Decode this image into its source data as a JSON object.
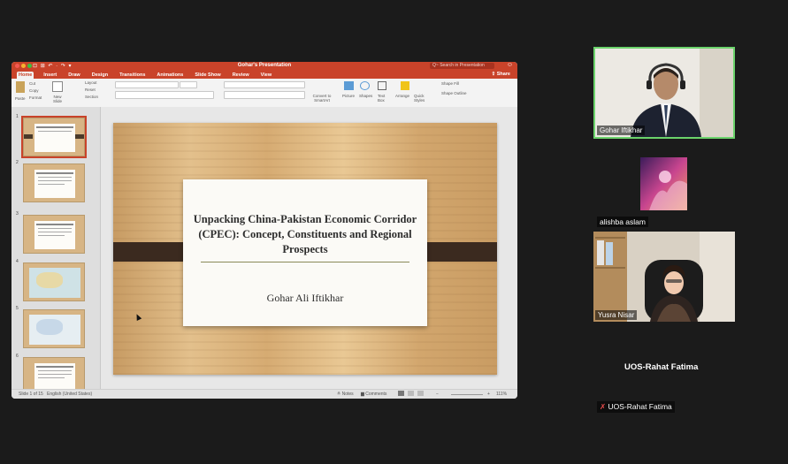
{
  "ppt": {
    "quick_access": "⊡ ⊞ ↶ · ↷ ▾",
    "doc_title": "Gohar's Presentation",
    "search_placeholder": "Q~ Search in Presentation",
    "account_icon": "☺",
    "share_label": "Share",
    "tabs": [
      "Home",
      "Insert",
      "Draw",
      "Design",
      "Transitions",
      "Animations",
      "Slide Show",
      "Review",
      "View"
    ],
    "ribbon": {
      "paste": "Paste",
      "cut": "Cut",
      "copy": "Copy",
      "format": "Format",
      "new_slide": "New Slide",
      "layout": "Layout",
      "reset": "Reset",
      "section": "Section",
      "convert": "Convert to SmartArt",
      "picture": "Picture",
      "shapes": "Shapes",
      "textbox": "Text Box",
      "arrange": "Arrange",
      "quick_styles": "Quick Styles",
      "shape_fill": "Shape Fill",
      "shape_outline": "Shape Outline"
    },
    "slide_numbers": [
      "1",
      "2",
      "3",
      "4",
      "5",
      "6"
    ],
    "slide": {
      "title": "Unpacking China-Pakistan Economic Corridor (CPEC): Concept, Constituents and Regional Prospects",
      "author": "Gohar Ali Iftikhar"
    },
    "status": {
      "slide_count": "Slide 1 of 15",
      "language": "English (United States)",
      "notes": "Notes",
      "comments": "Comments",
      "zoom": "111%"
    }
  },
  "participants": {
    "gohar": "Gohar Iftikhar",
    "alishba": "alishba aslam",
    "yusra": "Yusra Nisar",
    "rahat_big": "UOS-Rahat Fatima",
    "rahat_small": "UOS-Rahat Fatima"
  },
  "colors": {
    "accent": "#c9432a",
    "active_speaker": "#6bd36b"
  }
}
